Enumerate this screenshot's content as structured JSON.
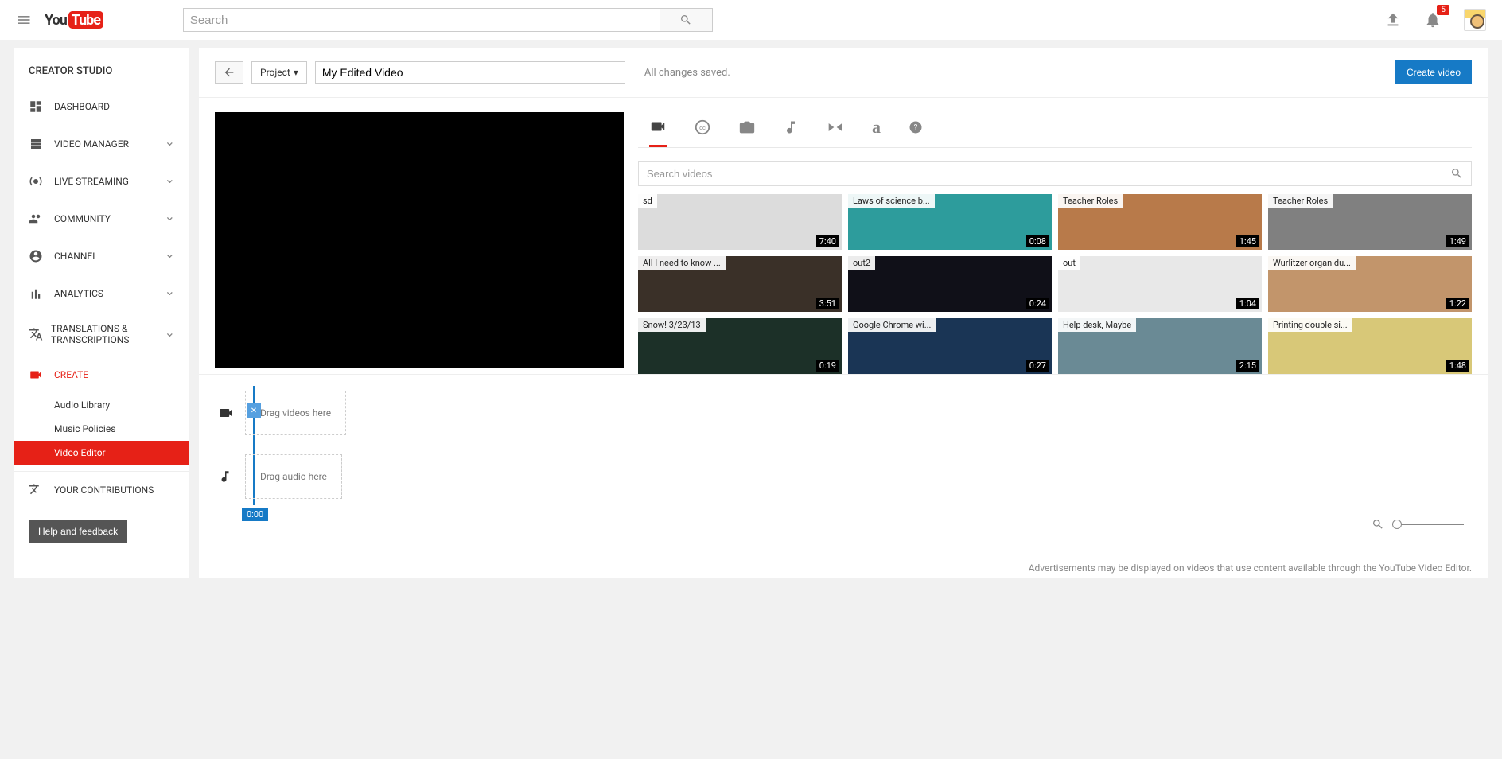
{
  "topbar": {
    "search_placeholder": "Search",
    "notification_count": "5"
  },
  "sidebar": {
    "title": "CREATOR STUDIO",
    "items": [
      {
        "label": "DASHBOARD"
      },
      {
        "label": "VIDEO MANAGER"
      },
      {
        "label": "LIVE STREAMING"
      },
      {
        "label": "COMMUNITY"
      },
      {
        "label": "CHANNEL"
      },
      {
        "label": "ANALYTICS"
      },
      {
        "label": "TRANSLATIONS & TRANSCRIPTIONS"
      },
      {
        "label": "CREATE"
      },
      {
        "label": "YOUR CONTRIBUTIONS"
      }
    ],
    "create_sub": [
      {
        "label": "Audio Library"
      },
      {
        "label": "Music Policies"
      },
      {
        "label": "Video Editor"
      }
    ],
    "help_label": "Help and feedback"
  },
  "toolbar": {
    "project_label": "Project",
    "title_value": "My Edited Video",
    "save_status": "All changes saved.",
    "create_label": "Create video"
  },
  "library": {
    "search_placeholder": "Search videos",
    "videos": [
      {
        "title": "sd",
        "duration": "7:40",
        "bg": "#dcdcdc"
      },
      {
        "title": "Laws of science b...",
        "duration": "0:08",
        "bg": "#2d9c9c"
      },
      {
        "title": "Teacher Roles",
        "duration": "1:45",
        "bg": "#b87a4a"
      },
      {
        "title": "Teacher Roles",
        "duration": "1:49",
        "bg": "#808080"
      },
      {
        "title": "All I need to know ...",
        "duration": "3:51",
        "bg": "#3a3028"
      },
      {
        "title": "out2",
        "duration": "0:24",
        "bg": "#101018"
      },
      {
        "title": "out",
        "duration": "1:04",
        "bg": "#e8e8e8"
      },
      {
        "title": "Wurlitzer organ du...",
        "duration": "1:22",
        "bg": "#c2956b"
      },
      {
        "title": "Snow! 3/23/13",
        "duration": "0:19",
        "bg": "#1c3028"
      },
      {
        "title": "Google Chrome wi...",
        "duration": "0:27",
        "bg": "#1a3555"
      },
      {
        "title": "Help desk, Maybe",
        "duration": "2:15",
        "bg": "#6a8a95"
      },
      {
        "title": "Printing double si...",
        "duration": "1:48",
        "bg": "#d8c878"
      }
    ]
  },
  "timeline": {
    "video_drop": "Drag videos here",
    "audio_drop": "Drag audio here",
    "playhead_time": "0:00"
  },
  "footer": {
    "note": "Advertisements may be displayed on videos that use content available through the YouTube Video Editor."
  }
}
